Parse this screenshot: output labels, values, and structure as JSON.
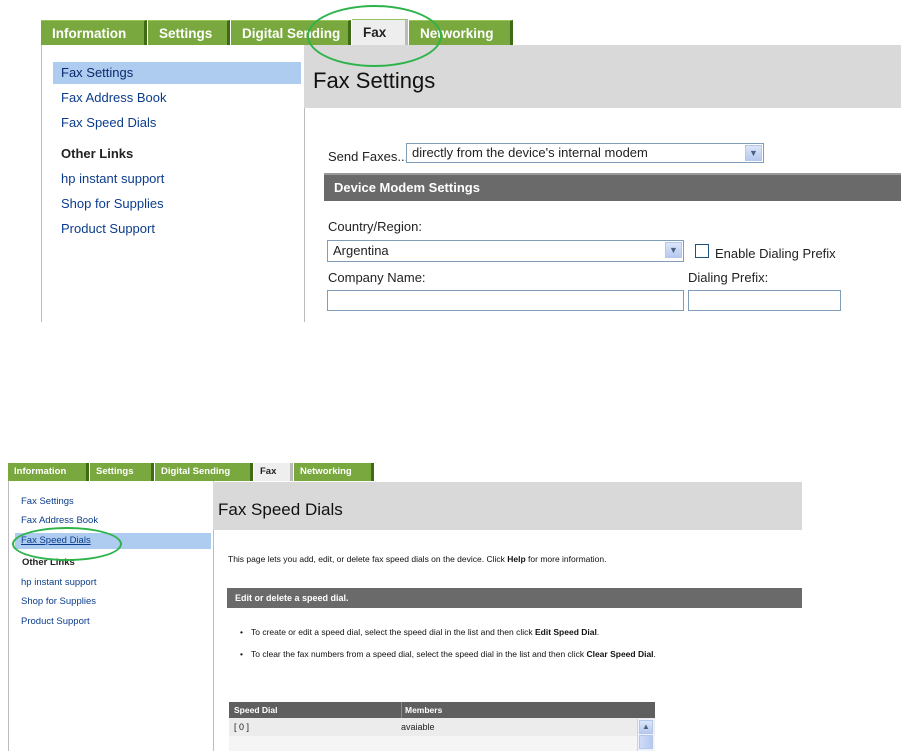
{
  "panel_top": {
    "tabs": [
      {
        "label": "Information"
      },
      {
        "label": "Settings"
      },
      {
        "label": "Digital Sending"
      },
      {
        "label": "Fax"
      },
      {
        "label": "Networking"
      }
    ],
    "nav": {
      "items": [
        {
          "label": "Fax Settings"
        },
        {
          "label": "Fax Address Book"
        },
        {
          "label": "Fax Speed Dials"
        }
      ],
      "other_links_heading": "Other Links",
      "other_links": [
        {
          "label": "hp instant support"
        },
        {
          "label": "Shop for Supplies"
        },
        {
          "label": "Product Support"
        }
      ]
    },
    "page_title": "Fax Settings",
    "send_faxes_label": "Send Faxes...",
    "send_faxes_value": "directly from the device's internal modem",
    "section_title": "Device Modem Settings",
    "country_label": "Country/Region:",
    "country_value": "Argentina",
    "enable_dialing_prefix_label": "Enable Dialing Prefix",
    "company_name_label": "Company Name:",
    "company_name_value": "",
    "dialing_prefix_label": "Dialing Prefix:",
    "dialing_prefix_value": ""
  },
  "panel_bottom": {
    "tabs": [
      {
        "label": "Information"
      },
      {
        "label": "Settings"
      },
      {
        "label": "Digital Sending"
      },
      {
        "label": "Fax"
      },
      {
        "label": "Networking"
      }
    ],
    "nav": {
      "items": [
        {
          "label": "Fax Settings"
        },
        {
          "label": "Fax Address Book"
        },
        {
          "label": "Fax Speed Dials"
        }
      ],
      "other_links_heading": "Other Links",
      "other_links": [
        {
          "label": "hp instant support"
        },
        {
          "label": "Shop for Supplies"
        },
        {
          "label": "Product Support"
        }
      ]
    },
    "page_title": "Fax Speed Dials",
    "description_pre": "This page lets you add, edit, or delete fax speed dials on the device. Click ",
    "description_help": "Help",
    "description_post": " for more information.",
    "section_title": "Edit or delete a speed dial.",
    "bullets": [
      {
        "pre": "To create or edit a speed dial, select the speed dial in the list and then click ",
        "strong": "Edit Speed Dial",
        "post": "."
      },
      {
        "pre": "To clear the fax numbers from a speed dial, select the speed dial in the list and then click ",
        "strong": "Clear Speed Dial",
        "post": "."
      }
    ],
    "table": {
      "headers": [
        "Speed Dial",
        "Members"
      ],
      "rows": [
        [
          "[ 0 ]",
          "avaiable"
        ]
      ]
    }
  },
  "colors": {
    "tab_green": "#79a83e",
    "nav_selected": "#aecbf0",
    "section_bar": "#6a6a6a",
    "annotation_circle": "#2db34a"
  }
}
